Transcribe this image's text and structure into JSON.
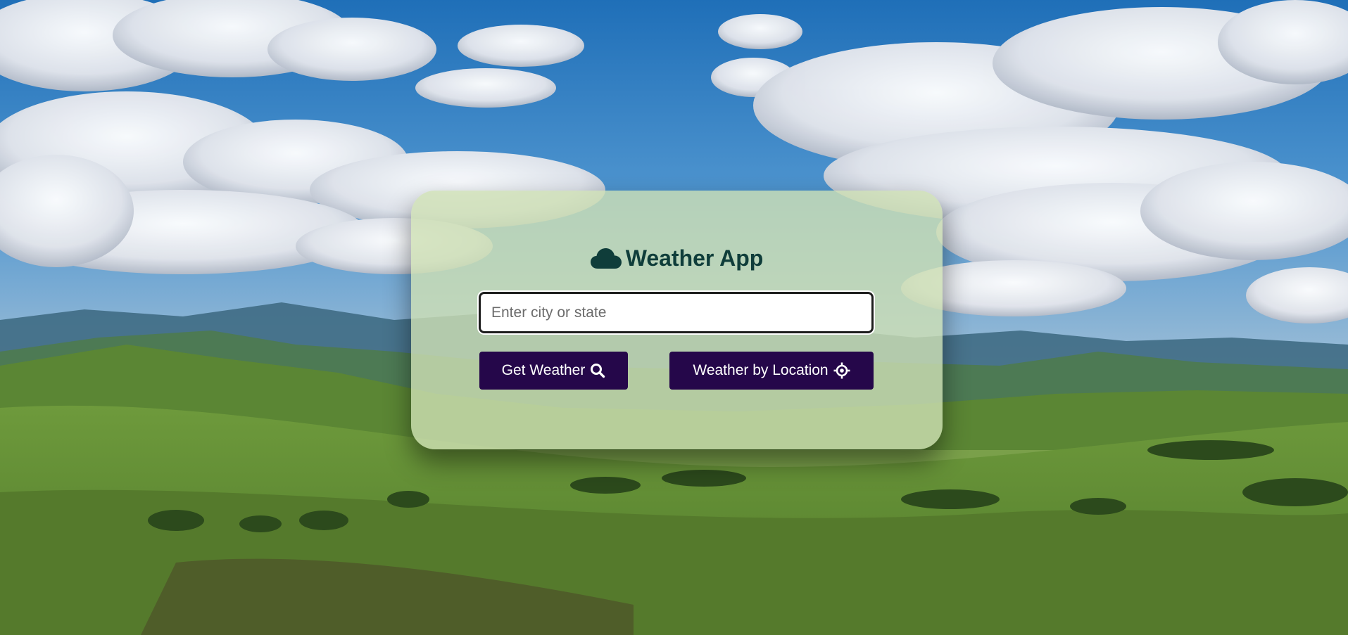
{
  "app": {
    "title": "Weather App",
    "title_icon": "cloud-icon"
  },
  "search": {
    "placeholder": "Enter city or state",
    "value": ""
  },
  "buttons": {
    "get_weather": {
      "label": "Get Weather",
      "icon": "search-icon"
    },
    "by_location": {
      "label": "Weather by Location",
      "icon": "crosshair-icon"
    }
  },
  "colors": {
    "title_text": "#0f3d3a",
    "button_bg": "#25074a",
    "button_text": "#ffffff",
    "card_bg": "#cee0b4"
  },
  "background": {
    "scene": "landscape-sky-hills"
  }
}
